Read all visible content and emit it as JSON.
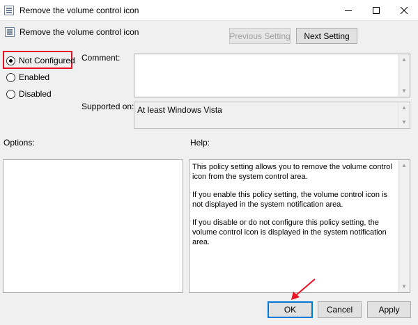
{
  "window": {
    "title": "Remove the volume control icon",
    "controls": {
      "minimize": "—",
      "maximize": "☐",
      "close": "✕"
    }
  },
  "header": {
    "policy_name": "Remove the volume control icon",
    "previous_label": "Previous Setting",
    "next_label": "Next Setting"
  },
  "state": {
    "options": [
      {
        "label": "Not Configured",
        "checked": true
      },
      {
        "label": "Enabled",
        "checked": false
      },
      {
        "label": "Disabled",
        "checked": false
      }
    ]
  },
  "comment": {
    "label": "Comment:",
    "value": ""
  },
  "supported": {
    "label": "Supported on:",
    "value": "At least Windows Vista"
  },
  "options_panel": {
    "label": "Options:"
  },
  "help": {
    "label": "Help:",
    "paragraphs": [
      "This policy setting allows you to remove the volume control icon from the system control area.",
      "If you enable this policy setting, the volume control icon is not displayed in the system notification area.",
      "If you disable or do not configure this policy setting, the volume control icon is displayed in the system notification area."
    ]
  },
  "footer": {
    "ok_label": "OK",
    "cancel_label": "Cancel",
    "apply_label": "Apply"
  },
  "colors": {
    "highlight": "#e81123",
    "annotation_arrow": "#e81123",
    "default_button_border": "#0078d7"
  }
}
